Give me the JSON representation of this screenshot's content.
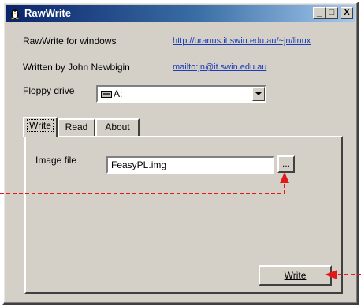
{
  "window": {
    "title": "RawWrite",
    "minimize": "_",
    "maximize": "□",
    "close": "X"
  },
  "info": {
    "app_label": "RawWrite for windows",
    "app_url": "http://uranus.it.swin.edu.au/~jn/linux",
    "author_label": "Written by John Newbigin",
    "author_mail": "mailto:jn@it.swin.edu.au"
  },
  "floppy": {
    "label": "Floppy drive",
    "value": "A:",
    "icon": "floppy-drive-icon"
  },
  "tabs": [
    {
      "label": "Write",
      "active": true
    },
    {
      "label": "Read",
      "active": false
    },
    {
      "label": "About",
      "active": false
    }
  ],
  "write_tab": {
    "image_label": "Image file",
    "image_value": "FeasyPL.img",
    "browse_label": "...",
    "write_label": "Write"
  },
  "colors": {
    "annotation_arrow": "#e0191c",
    "title_bar": "#0a246a",
    "face": "#d4d0c8"
  }
}
